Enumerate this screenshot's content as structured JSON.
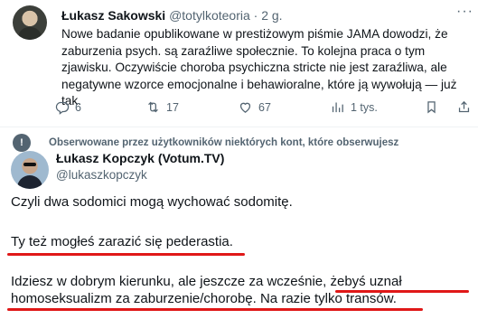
{
  "tweet1": {
    "author_name": "Łukasz Sakowski",
    "author_handle": "@totylkoteoria",
    "separator": " · ",
    "time": "2 g.",
    "more": "···",
    "text": "Nowe badanie opublikowane w prestiżowym piśmie JAMA dowodzi, że zaburzenia psych. są zaraźliwe społecznie. To kolejna praca o tym zjawisku. Oczywiście choroba psychiczna stricte nie jest zaraźliwa, ale negatywne wzorce emocjonalne i behawioralne, które ją wywołują — już tak.",
    "actions": {
      "replies": "6",
      "retweets": "17",
      "likes": "67",
      "views": "1 tys."
    }
  },
  "notice": {
    "icon": "!",
    "text": "Obserwowane przez użytkowników niektórych kont, które obserwujesz"
  },
  "tweet2": {
    "author_name": "Łukasz Kopczyk (Votum.TV)",
    "author_handle": "@lukaszkopczyk",
    "para1": "Czyli dwa sodomici mogą wychować sodomitę.",
    "para2": "Ty też mogłeś zarazić się pederastia.",
    "para3_line1": "Idziesz w dobrym kierunku, ale jeszcze za wcześnie, żebyś uznał",
    "para3_line2": "homoseksualizm za zaburzenie/chorobę.  Na razie tylko transów."
  },
  "colors": {
    "text": "#0f1419",
    "secondary": "#536471",
    "underline": "#e01818",
    "divider": "#eff3f4"
  },
  "icons": [
    "reply-icon",
    "retweet-icon",
    "like-icon",
    "views-icon",
    "bookmark-icon",
    "share-icon",
    "more-icon",
    "notice-icon"
  ]
}
